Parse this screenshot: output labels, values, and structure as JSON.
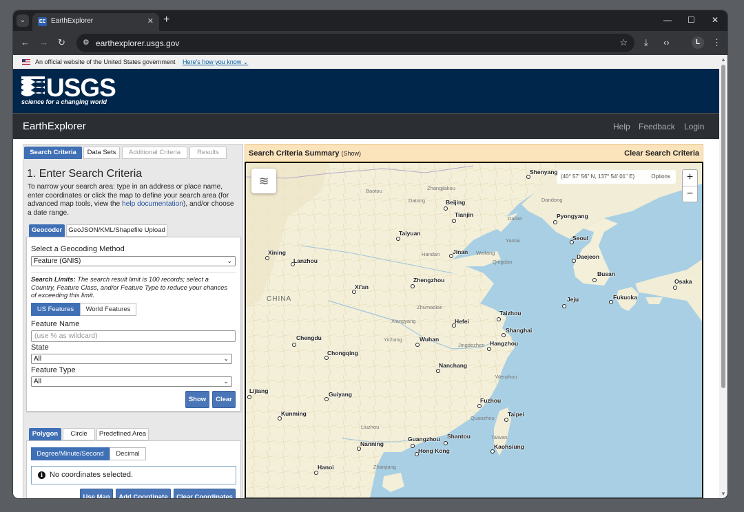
{
  "browser": {
    "tab_title": "EarthExplorer",
    "favicon_text": "EE",
    "url": "earthexplorer.usgs.gov",
    "profile_initial": "L"
  },
  "gov_banner": {
    "text": "An official website of the United States government",
    "link": "Here's how you know"
  },
  "usgs": {
    "logo": "USGS",
    "tagline": "science for a changing world"
  },
  "nav": {
    "title": "EarthExplorer",
    "links": [
      "Help",
      "Feedback",
      "Login"
    ]
  },
  "left_tabs": [
    "Search Criteria",
    "Data Sets",
    "Additional Criteria",
    "Results"
  ],
  "step_title": "1. Enter Search Criteria",
  "intro": {
    "before": "To narrow your search area: type in an address or place name, enter coordinates or click the map to define your search area (for advanced map tools, view the ",
    "link": "help documentation",
    "after": "), and/or choose a date range."
  },
  "geo_tabs": [
    "Geocoder",
    "GeoJSON/KML/Shapefile Upload"
  ],
  "geocoder": {
    "method_label": "Select a Geocoding Method",
    "method_value": "Feature (GNIS)",
    "limits_bold": "Search Limits:",
    "limits_text": " The search result limit is 100 records; select a Country, Feature Class, and/or Feature Type to reduce your chances of exceeding this limit.",
    "feature_tabs": [
      "US Features",
      "World Features"
    ],
    "feature_name_label": "Feature Name",
    "feature_name_placeholder": "(use % as wildcard)",
    "state_label": "State",
    "state_value": "All",
    "type_label": "Feature Type",
    "type_value": "All",
    "show": "Show",
    "clear": "Clear"
  },
  "polygon": {
    "tabs": [
      "Polygon",
      "Circle",
      "Predefined Area"
    ],
    "format_tabs": [
      "Degree/Minute/Second",
      "Decimal"
    ],
    "message": "No coordinates selected.",
    "buttons": [
      "Use Map",
      "Add Coordinate",
      "Clear Coordinates"
    ]
  },
  "summary": {
    "title": "Search Criteria Summary",
    "show": "(Show)",
    "clear": "Clear Search Criteria"
  },
  "map": {
    "coords": "(40° 57' 56\" N, 137° 54' 01\" E)",
    "options": "Options",
    "zoom_in": "+",
    "zoom_out": "−",
    "country": "CHINA",
    "cities": [
      "Shenyang",
      "Beijing",
      "Tianjin",
      "Pyongyang",
      "Seoul",
      "Daejeon",
      "Busan",
      "Fukuoka",
      "Osaka",
      "Jeju",
      "Taiyuan",
      "Jinan",
      "Xining",
      "Lanzhou",
      "Xi'an",
      "Zhengzhou",
      "Taizhou",
      "Shanghai",
      "Hefei",
      "Hangzhou",
      "Chengdu",
      "Wuhan",
      "Chongqing",
      "Nanchang",
      "Lijiang",
      "Guiyang",
      "Fuzhou",
      "Taipei",
      "Kunming",
      "Nanning",
      "Guangzhou",
      "Shantou",
      "Hong Kong",
      "Kaohsiung",
      "Hanoi"
    ],
    "minor": [
      "Baotou",
      "Zhangjiakou",
      "Datong",
      "Dandong",
      "Dalian",
      "Yantai",
      "Handan",
      "Weifang",
      "Qingdao",
      "Zhumadian",
      "Xiangyang",
      "Yichang",
      "Jingdezhen",
      "Wenzhou",
      "Quanzhou",
      "Taiwan",
      "Liuzhou",
      "Zhanjiang"
    ]
  }
}
